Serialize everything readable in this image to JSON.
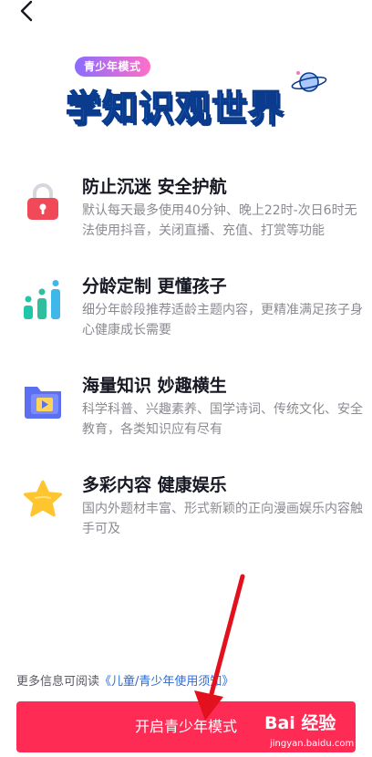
{
  "nav": {
    "back_icon": "chevron-left-icon"
  },
  "hero": {
    "badge": "青少年模式",
    "title": "学知识观世界",
    "planet_icon": "planet-icon"
  },
  "features": [
    {
      "icon": "lock-icon",
      "title": "防止沉迷 安全护航",
      "desc": "默认每天最多使用40分钟、晚上22时-次日6时无法使用抖音，关闭直播、充值、打赏等功能"
    },
    {
      "icon": "bar-chart-icon",
      "title": "分龄定制 更懂孩子",
      "desc": "细分年龄段推荐适龄主题内容，更精准满足孩子身心健康成长需要"
    },
    {
      "icon": "video-folder-icon",
      "title": "海量知识 妙趣横生",
      "desc": "科学科普、兴趣素养、国学诗词、传统文化、安全教育，各类知识应有尽有"
    },
    {
      "icon": "star-icon",
      "title": "多彩内容 健康娱乐",
      "desc": "国内外题材丰富、形式新颖的正向漫画娱乐内容触手可及"
    }
  ],
  "footer": {
    "prefix": "更多信息可阅读",
    "link": "《儿童/青少年使用须知》"
  },
  "cta": {
    "label": "开启青少年模式"
  },
  "watermark": {
    "brand": "Bai 经验",
    "url": "jingyan.baidu.com"
  },
  "colors": {
    "primary": "#fe2c55",
    "link": "#2b6bd9",
    "title_blue": "#1f8ef1"
  }
}
